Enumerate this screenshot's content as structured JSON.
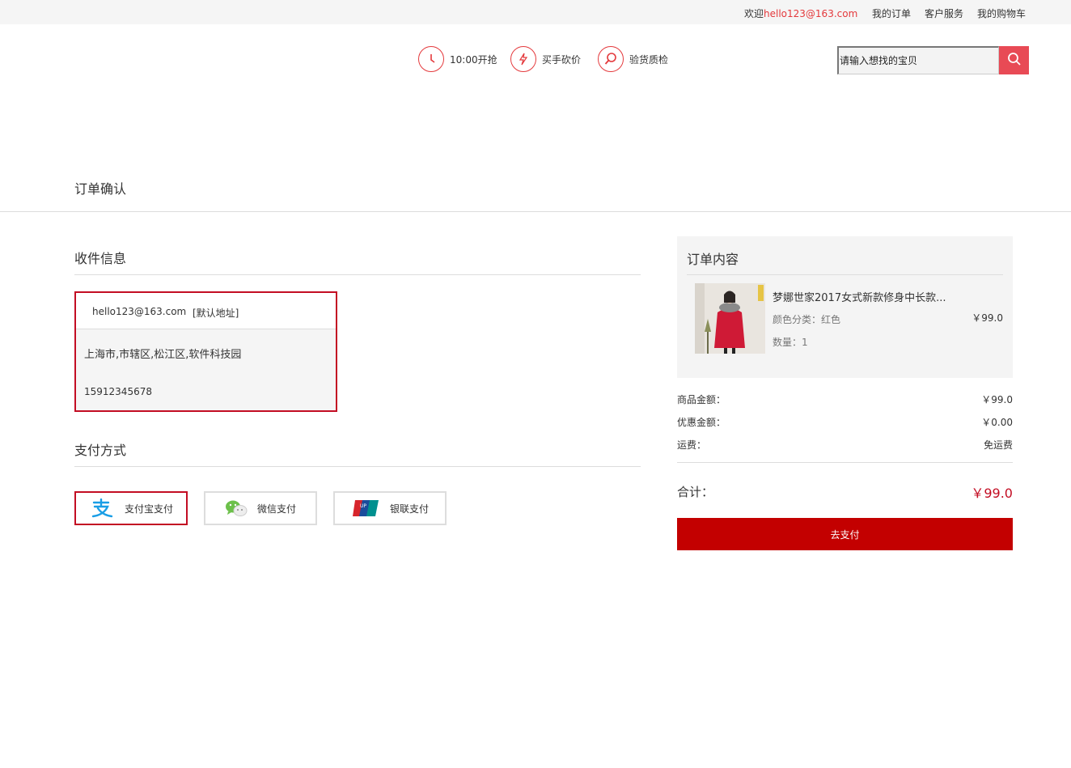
{
  "topbar": {
    "welcome_prefix": "欢迎",
    "user": "hello123@163.com",
    "links": [
      "我的订单",
      "客户服务",
      "我的购物车"
    ]
  },
  "features": [
    {
      "icon": "clock-icon",
      "label": "10:00开抢"
    },
    {
      "icon": "lightning-icon",
      "label": "买手砍价"
    },
    {
      "icon": "magnifier-icon",
      "label": "验货质检"
    }
  ],
  "search": {
    "placeholder": "请输入想找的宝贝",
    "button_icon": "search-icon"
  },
  "page_title": "订单确认",
  "shipping": {
    "title": "收件信息",
    "email": "hello123@163.com",
    "default_tag": "[默认地址]",
    "address": "上海市,市辖区,松江区,软件科技园",
    "phone": "15912345678"
  },
  "payment": {
    "title": "支付方式",
    "methods": [
      {
        "icon": "alipay-icon",
        "label": "支付宝支付",
        "selected": true
      },
      {
        "icon": "wechat-icon",
        "label": "微信支付",
        "selected": false
      },
      {
        "icon": "unionpay-icon",
        "label": "银联支付",
        "selected": false
      }
    ]
  },
  "order": {
    "title": "订单内容",
    "item": {
      "name": "梦娜世家2017女式新款修身中长款...",
      "color": "颜色分类：红色",
      "qty": "数量：1",
      "price": "￥99.0"
    }
  },
  "summary": {
    "goods_label": "商品金额：",
    "goods_value": "￥99.0",
    "discount_label": "优惠金额：",
    "discount_value": "￥0.00",
    "shipping_label": "运费：",
    "shipping_value": "免运费",
    "total_label": "合计：",
    "total_value": "￥99.0",
    "pay_button": "去支付"
  },
  "colors": {
    "accent": "#c30d23",
    "brand": "#e4393c",
    "pay_button": "#c30000"
  }
}
